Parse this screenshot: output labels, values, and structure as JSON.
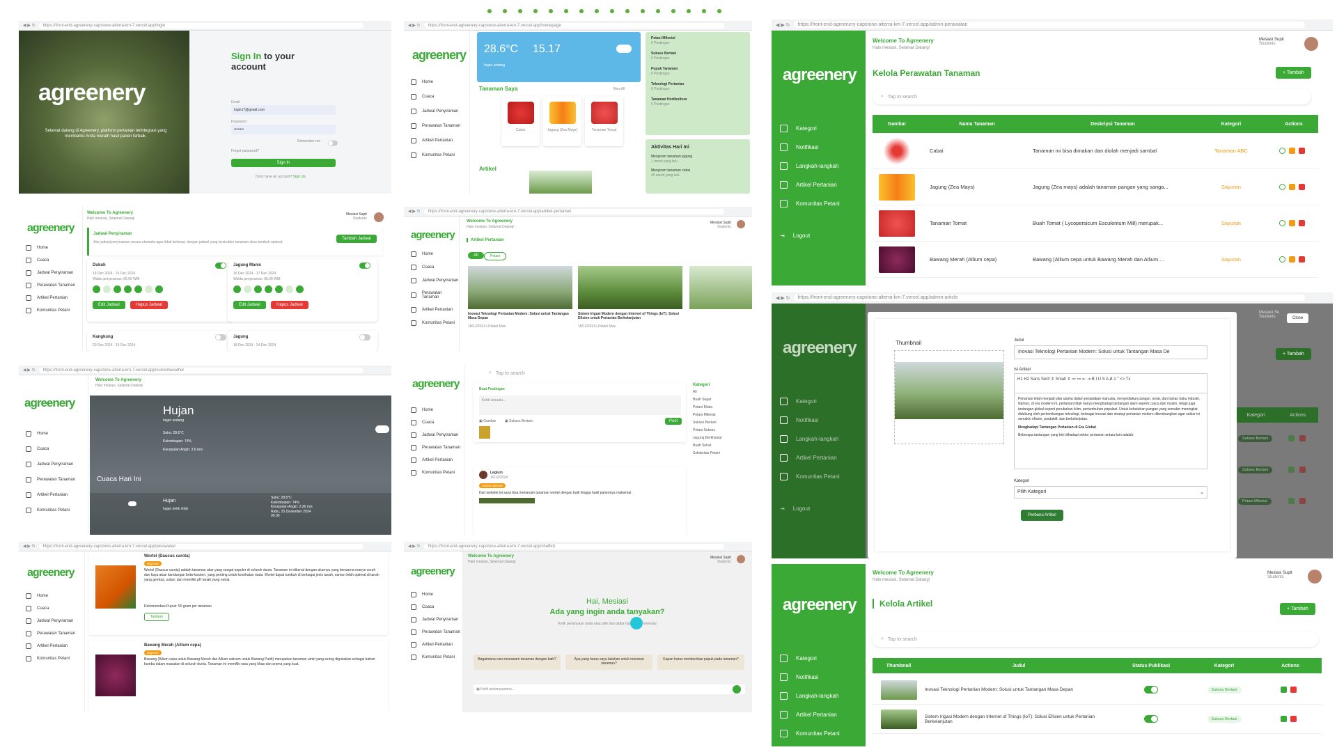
{
  "dots_count": 16,
  "brand": "agreenery",
  "colors": {
    "accent": "#3aa935",
    "danger": "#e53935",
    "sky": "#5db8e8"
  },
  "login": {
    "url": "https://front-end-agreenery-capstone-alterra-km-7.vercel.app/login",
    "tagline": "Selamat datang di Agreenery, platform pertanian terintegrasi yang membantu Anda meraih hasil panen terbaik.",
    "title_green": "Sign In",
    "title_rest": " to your account",
    "email_label": "Email",
    "email_value": "login17@gmail.com",
    "password_label": "Password",
    "password_value": "••••••••",
    "remember": "Remember me",
    "forgot": "Forgot password?",
    "signin": "Sign In",
    "no_account": "Don't have an account?",
    "signup": "Sign Up"
  },
  "home": {
    "url": "https://front-end-agreenery-capstone-alterra-km-7.vercel.app/homepage",
    "temp": "28.6°C",
    "time": "15.17",
    "weather": "hujan sedang",
    "my_plants": "Tanaman Saya",
    "see_all": "View All",
    "plants": [
      "Cabai",
      "Jagung (Zea Mays)",
      "Tanaman Tomat"
    ],
    "articles": "Artikel",
    "side_items": [
      {
        "title": "Petani Milenial",
        "sub": "0 Postingan"
      },
      {
        "title": "Sukses Bertani",
        "sub": "0 Postingan"
      },
      {
        "title": "Pupuk Tanaman",
        "sub": "0 Postingan"
      },
      {
        "title": "Teknologi Pertanian",
        "sub": "0 Postingan"
      },
      {
        "title": "Tanaman Hortikultura",
        "sub": "0 Postingan"
      }
    ],
    "activity_title": "Aktivitas Hari Ini",
    "activities": [
      {
        "title": "Menyiram tanaman jagung",
        "sub": "1 menit yang lalu"
      },
      {
        "title": "Menyiram tanaman cabai",
        "sub": "45 menit yang lalu"
      }
    ]
  },
  "user_nav": [
    "Home",
    "Cuaca",
    "Jadwal Penyiraman",
    "Perawatan Tanaman",
    "Artikel Pertanian",
    "Komunitas Petani"
  ],
  "welcome": "Welcome To Agreenery",
  "welcome_sub": "Halo mesiasi, Selamat Datang!",
  "user_name": "Mesiasi Supit",
  "user_role": "Students",
  "schedule": {
    "title": "Jadwal Penyiraman",
    "desc": "Atur jadwal penyiraman secara otomatis agar tidak terlewat, dengan jadwal yang terstruktur tanaman akan tumbuh optimal.",
    "add": "Tambah Jadwal",
    "cards": [
      {
        "name": "Dukuh",
        "date": "19 Dec 2024 - 15 Dec 2024",
        "time": "Waktu penyiraman: 06.00 WIB",
        "on": true
      },
      {
        "name": "Jagung Manis",
        "date": "16 Dec 2024 - 17 Dec 2024",
        "time": "Waktu penyiraman: 06.00 WIB",
        "on": true
      },
      {
        "name": "Kangkung",
        "date": "20 Dec 2024 - 15 Dec 2024",
        "on": false
      },
      {
        "name": "Jagung",
        "date": "18 Dec 2024 - 24 Dec 2024",
        "on": false
      }
    ],
    "edit": "Edit Jadwal",
    "delete": "Hapus Jadwal"
  },
  "artikel_page": {
    "url": "https://front-end-agreenery-capstone-alterra-km-7.vercel.app/artikel-pertanian",
    "title": "Artikel Pertanian",
    "filter_all": "All",
    "filter_2": "Petani",
    "cards": [
      {
        "title": "Inovasi Teknologi Pertanian Modern: Solusi untuk Tantangan Masa Depan",
        "date": "18/12/2024 | Petani Mas"
      },
      {
        "title": "Sistem Irigasi Modern dengan Internet of Things (IoT): Solusi Efisien untuk Pertanian Berkelanjutan",
        "date": "18/12/2024 | Petani Mas"
      }
    ]
  },
  "weather_page": {
    "url": "https://front-end-agreenery-capstone-alterra-km-7.vercel.app/currentweather",
    "title": "Hujan",
    "sub": "hujan sedang",
    "suhu": "Suhu: 28.6°C",
    "kelembapan": "Kelembapan: 74%",
    "angin": "Kecepatan Angin: 3.6 m/s",
    "today": "Cuaca Hari Ini",
    "f_title": "Hujan",
    "f_sub": "hujan rintik rintik",
    "f_suhu": "Suhu: 28.6°C",
    "f_kel": "Kelembaban: 74%",
    "f_ang": "Kecepatan Angin: 2.26 m/s",
    "f_date": "Rabu, 25 Desember 2024",
    "f_time": "09.00"
  },
  "community": {
    "search": "Tap to search",
    "post_title": "Buat Postingan",
    "placeholder": "Ketik sesuatu...",
    "image": "Gambar",
    "tag": "Sukses Bertani",
    "post_btn": "Post",
    "author": "Legium",
    "author_date": "16/12/2024",
    "post_tag": "Sukses Bertani",
    "post_text": "Dari website ini saya bisa menanam tanaman wortel dengan baik hingga hasil panennya maksimal",
    "kategori": "Kategori",
    "cats": [
      "All",
      "Buah Segar",
      "Petani Muda",
      "Petani Milenial",
      "Sukses Bertani",
      "Petani Sukses",
      "Jagung Berkhasiat",
      "Buah Sehat",
      "Solidaritas Petani"
    ]
  },
  "care_page": {
    "url": "https://front-end-agreenery-capstone-alterra-km-7.vercel.app/perawatan",
    "items": [
      {
        "title": "Wortel (Daucus carota)",
        "badge": "Sayuran",
        "desc": "Wortel (Daucus carota) adalah tanaman akar yang sangat populer di seluruh dunia. Tanaman ini dikenal dengan akarnya yang berwarna oranye cerah dan kaya akan kandungan beta-karoten, yang penting untuk kesehatan mata. Wortel dapat tumbuh di berbagai jenis tanah, namun lebih optimal di tanah yang gembur, subur, dan memiliki pH tanah yang netral.",
        "rec": "Rekomendasi Pupuk: 50 gram per tanaman",
        "btn": "Tambah"
      },
      {
        "title": "Bawang Merah (Allium cepa)",
        "badge": "Sayuran",
        "desc": "Bawang (Allium cepa untuk Bawang Merah dan Allium sativum untuk Bawang Putih) merupakan tanaman umbi yang sering digunakan sebagai bahan bumbu dalam masakan di seluruh dunia. Tanaman ini memiliki rasa yang khas dan aroma yang kuat."
      }
    ]
  },
  "chat": {
    "url": "https://front-end-agreenery-capstone-alterra-km-7.vercel.app/chatbot",
    "hi": "Hai, Mesiasi",
    "question": "Ada yang ingin anda tanyakan?",
    "hint": "Ketik pertanyaan anda atau pilih dari daftar topik untuk memulai",
    "suggestions": [
      "Bagaimana cara menanam tanaman dengan baik?",
      "Apa yang harus saya lakukan untuk merawat tanaman?",
      "Kapan harus memberikan pupuk pada tanaman?"
    ],
    "input": "Ketik pertanyaanmu..."
  },
  "admin": {
    "url_care": "https://front-end-agreenery-capstone-alterra-km-7.vercel.app/admin-perawatan",
    "url_article": "https://front-end-agreenery-capstone-alterra-km-7.vercel.app/admin-article",
    "nav": [
      "Kategori",
      "Notifikasi",
      "Langkah-langkah",
      "Artikel Pertanian",
      "Komunitas Petani"
    ],
    "logout": "Logout",
    "care_title": "Kelola Perawatan Tanaman",
    "add": "+ Tambah",
    "search": "Tap to search",
    "care_cols": [
      "Gambar",
      "Nama Tanaman",
      "Deskripsi Tanaman",
      "Kategori",
      "Actions"
    ],
    "care_rows": [
      {
        "name": "Cabai",
        "desc": "Tanaman ini bisa dimakan dan diolah menjadi sambal",
        "cat": "Tanaman ABC"
      },
      {
        "name": "Jagung (Zea Mays)",
        "desc": "Jagung (Zea mays) adalah tanaman pangan yang sanga...",
        "cat": "Sayuran"
      },
      {
        "name": "Tanaman Tomat",
        "desc": "Buah Tomat ( Lycopersicum Esculentum Mill) merupak...",
        "cat": "Sayuran"
      },
      {
        "name": "Bawang Merah (Allium cepa)",
        "desc": "Bawang (Allium cepa untuk Bawang Merah dan Allium ...",
        "cat": "Sayuran"
      }
    ],
    "modal": {
      "close": "Close",
      "thumb": "Thumbnail",
      "judul_label": "Judul",
      "judul": "Inovasi Teknologi Pertanian Modern: Solusi untuk Tantangan Masa De",
      "isi_label": "Isi Artikel",
      "toolbar": "H1 H2 Sans Serif ⇕ Small ⇕ ≔ ≔ ⇤ ⇥  B I U S A Ⱥ ≡ \" <> Tx",
      "body": "Pertanian telah menjadi pilar utama dalam peradaban manusia, menyediakan pangan, serat, dan bahan baku industri. Namun, di era modern ini, pertanian tidak hanya menghadapi tantangan alam seperti cuaca dan musim, tetapi juga tantangan global seperti perubahan iklim, pertumbuhan populasi. Untuk kebutuhan pangan yang semakin meningkat didukung oleh perkembangan teknologi, berbagai inovasi dan strategi pertanian modern dikembangkan agar sektor ini semakin efisien, produktif, dan berkelanjutan.",
      "heading": "Menghadapi Tantangan Pertanian di Era Global",
      "body2": "Beberapa tantangan yang kini dihadapi sektor pertanian antara lain adalah:",
      "kategori_label": "Kategori",
      "kategori": "Pilih Kategori",
      "submit": "Perbarui Artikel",
      "bg_user": "Mesiasi Su",
      "bg_role": "Students",
      "bg_col": "Kategori",
      "bg_col2": "Actions",
      "bg_cats": [
        "Sukses Bertani",
        "Sukses Bertani",
        "Petani Milenial"
      ]
    },
    "article_title": "Kelola Artikel",
    "article_cols": [
      "Thumbnail",
      "Judul",
      "Status Publikasi",
      "Kategori",
      "Actions"
    ],
    "article_rows": [
      {
        "title": "Inovasi Teknologi Pertanian Modern: Solusi untuk Tantangan Masa Depan",
        "cat": "Sukses Bertani"
      },
      {
        "title": "Sistem Irigasi Modern dengan Internet of Things (IoT): Solusi Efisien untuk Pertanian Berkelanjutan",
        "cat": "Sukses Bertani"
      }
    ]
  }
}
